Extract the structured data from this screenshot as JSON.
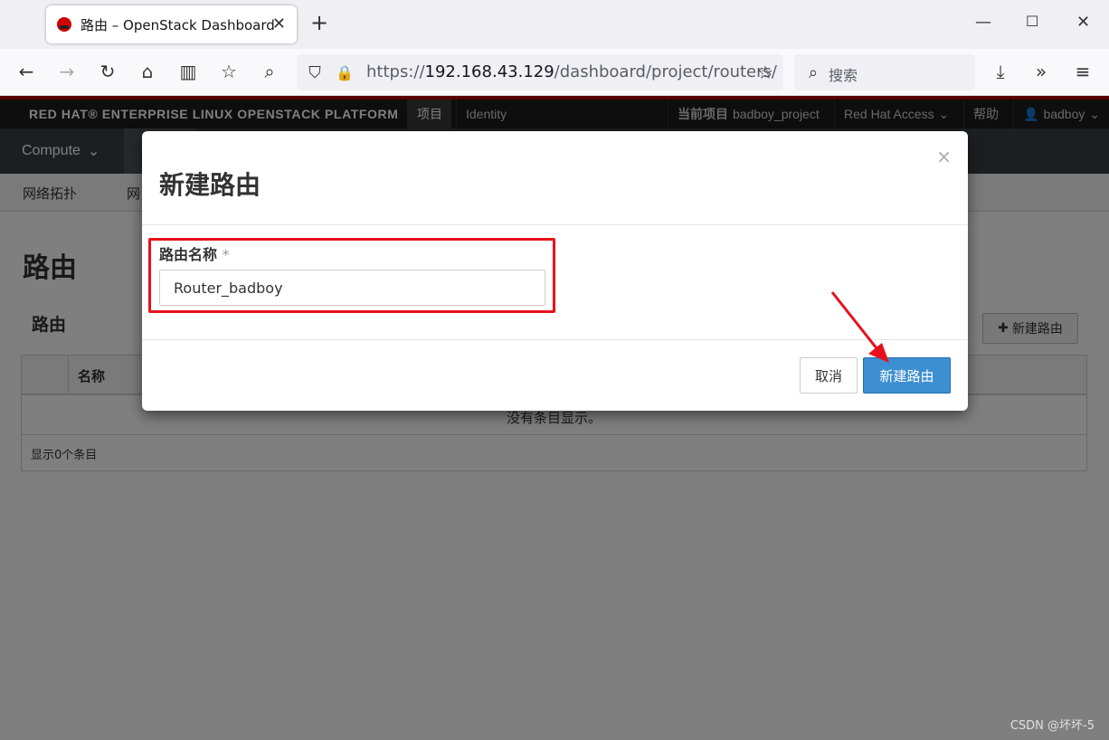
{
  "browser": {
    "tab_title": "路由 – OpenStack Dashboard",
    "url_prefix": "https://",
    "url_host": "192.168.43.129",
    "url_path": "/dashboard/project/routers/",
    "search_placeholder": "搜索"
  },
  "topbar": {
    "brand": "RED HAT® ENTERPRISE LINUX OPENSTACK PLATFORM",
    "items": [
      "项目",
      "Identity"
    ],
    "current_project_label": "当前项目",
    "current_project": "badboy_project",
    "red_hat_access": "Red Hat Access",
    "help": "帮助",
    "user": "badboy"
  },
  "nav": {
    "compute": "Compute"
  },
  "subnav": {
    "topology": "网络拓扑",
    "network": "网"
  },
  "page": {
    "title": "路由",
    "section_title": "路由",
    "create_button": "新建路由",
    "table_header_name": "名称",
    "empty_text": "没有条目显示。",
    "footer": "显示0个条目"
  },
  "modal": {
    "title": "新建路由",
    "close": "×",
    "field_label": "路由名称",
    "required_mark": "*",
    "field_value": "Router_badboy",
    "cancel": "取消",
    "submit": "新建路由"
  },
  "watermark": "CSDN @坏坏-5",
  "colors": {
    "accent": "#3d8fd1",
    "highlight": "#e8111b",
    "brand_red": "#b20000"
  }
}
